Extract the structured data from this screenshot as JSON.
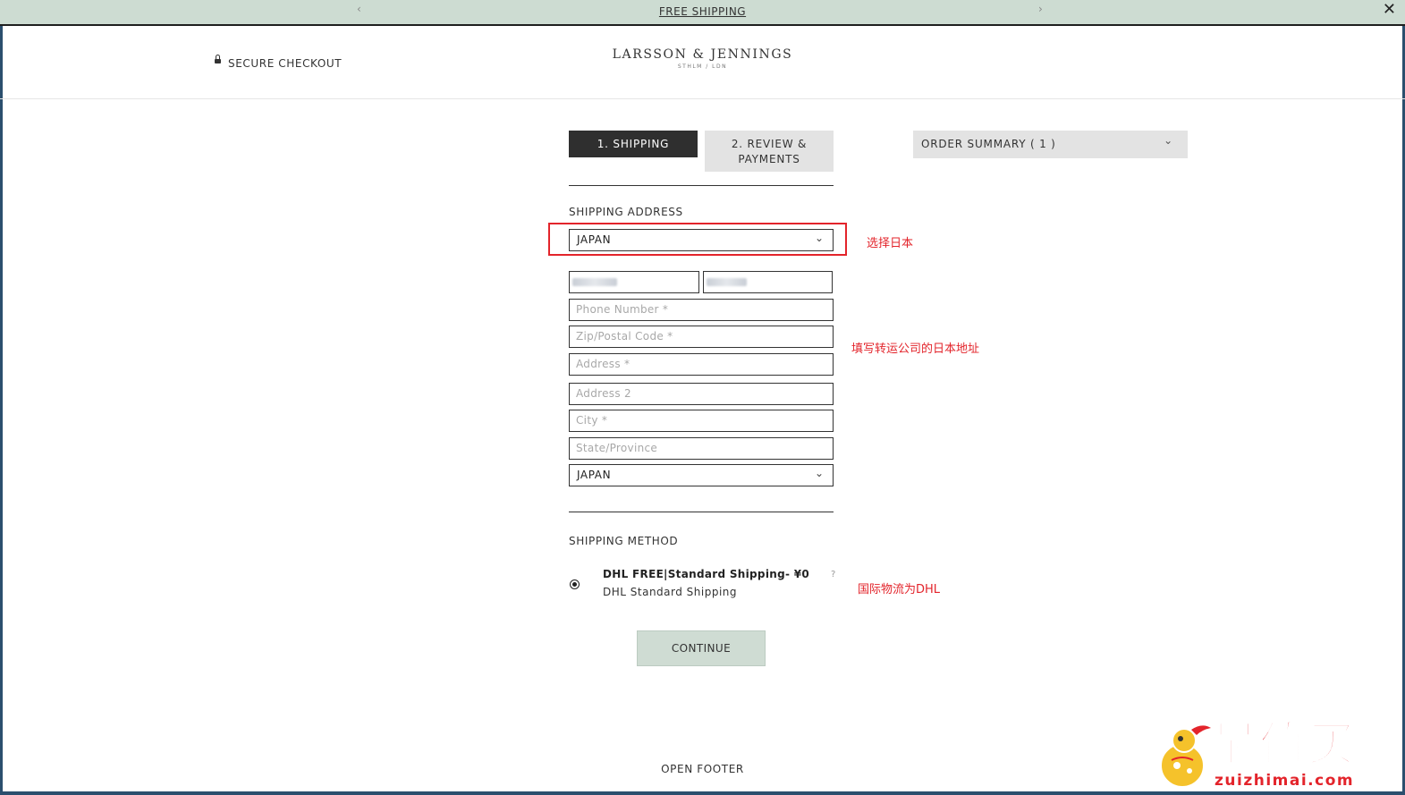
{
  "topbar": {
    "promo": "FREE SHIPPING",
    "prev": "‹",
    "next": "›",
    "close": "✕"
  },
  "header": {
    "secure_checkout": "SECURE CHECKOUT",
    "logo_name": "LARSSON & JENNINGS",
    "logo_sub": "STHLM / LDN"
  },
  "steps": {
    "step1": "1. SHIPPING",
    "step2_line1": "2. REVIEW &",
    "step2_line2": "PAYMENTS"
  },
  "order_summary": {
    "label": "ORDER SUMMARY ( 1 )"
  },
  "shipping_address": {
    "heading": "SHIPPING ADDRESS",
    "country_top": "JAPAN",
    "phone_placeholder": "Phone Number *",
    "zip_placeholder": "Zip/Postal Code *",
    "address_placeholder": "Address *",
    "address2_placeholder": "Address 2",
    "city_placeholder": "City *",
    "state_placeholder": "State/Province",
    "country_bottom": "JAPAN"
  },
  "shipping_method": {
    "heading": "SHIPPING METHOD",
    "title": "DHL FREE|Standard Shipping- ¥0",
    "subtitle": "DHL Standard Shipping",
    "help": "?"
  },
  "buttons": {
    "continue": "CONTINUE",
    "open_footer": "OPEN FOOTER"
  },
  "annotations": {
    "select_japan": "选择日本",
    "fill_address": "填写转运公司的日本地址",
    "dhl": "国际物流为DHL"
  },
  "watermark": {
    "text": "最值买",
    "domain": "zuizhimai.com"
  },
  "colors": {
    "accent_green": "#cfdcd3",
    "dark": "#2f2f2f",
    "annotation_red": "#e3242b"
  }
}
